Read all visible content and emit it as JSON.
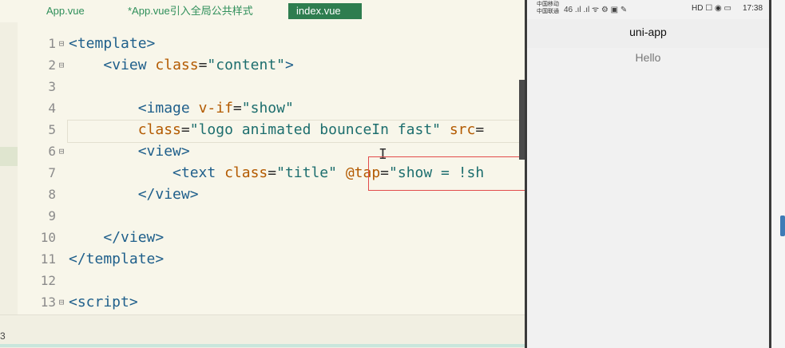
{
  "tabs": [
    {
      "label": "App.vue",
      "active": false
    },
    {
      "label": "*App.vue引入全局公共样式",
      "active": false
    },
    {
      "label": "index.vue",
      "active": true
    }
  ],
  "line_numbers": [
    "1",
    "2",
    "3",
    "4",
    "5",
    "6",
    "7",
    "8",
    "9",
    "10",
    "11",
    "12",
    "13"
  ],
  "code_lines": [
    {
      "indent": "",
      "tokens": [
        {
          "t": "<template>",
          "c": "tok-tag"
        }
      ]
    },
    {
      "indent": "    ",
      "tokens": [
        {
          "t": "<view ",
          "c": "tok-tag"
        },
        {
          "t": "class",
          "c": "tok-attr"
        },
        {
          "t": "=",
          "c": "tok-op"
        },
        {
          "t": "\"content\"",
          "c": "tok-str"
        },
        {
          "t": ">",
          "c": "tok-tag"
        }
      ]
    },
    {
      "indent": "",
      "tokens": []
    },
    {
      "indent": "        ",
      "tokens": [
        {
          "t": "<image ",
          "c": "tok-tag"
        },
        {
          "t": "v-if",
          "c": "tok-attr"
        },
        {
          "t": "=",
          "c": "tok-op"
        },
        {
          "t": "\"show\"",
          "c": "tok-str"
        }
      ]
    },
    {
      "indent": "        ",
      "tokens": [
        {
          "t": "class",
          "c": "tok-attr"
        },
        {
          "t": "=",
          "c": "tok-op"
        },
        {
          "t": "\"logo animated bounceIn fast\" ",
          "c": "tok-str"
        },
        {
          "t": "src",
          "c": "tok-attr"
        },
        {
          "t": "=",
          "c": "tok-op"
        }
      ]
    },
    {
      "indent": "        ",
      "tokens": [
        {
          "t": "<view>",
          "c": "tok-tag"
        }
      ]
    },
    {
      "indent": "            ",
      "tokens": [
        {
          "t": "<text ",
          "c": "tok-tag"
        },
        {
          "t": "class",
          "c": "tok-attr"
        },
        {
          "t": "=",
          "c": "tok-op"
        },
        {
          "t": "\"title\" ",
          "c": "tok-str"
        },
        {
          "t": "@tap",
          "c": "tok-attr"
        },
        {
          "t": "=",
          "c": "tok-op"
        },
        {
          "t": "\"show = !sh",
          "c": "tok-str"
        }
      ]
    },
    {
      "indent": "        ",
      "tokens": [
        {
          "t": "</view>",
          "c": "tok-tag"
        }
      ]
    },
    {
      "indent": "",
      "tokens": []
    },
    {
      "indent": "    ",
      "tokens": [
        {
          "t": "</view>",
          "c": "tok-tag"
        }
      ]
    },
    {
      "indent": "",
      "tokens": [
        {
          "t": "</template>",
          "c": "tok-tag"
        }
      ]
    },
    {
      "indent": "",
      "tokens": []
    },
    {
      "indent": "",
      "tokens": [
        {
          "t": "<script>",
          "c": "tok-tag"
        }
      ]
    }
  ],
  "bottom_left_text": "3",
  "phone": {
    "carrier_line1": "中国移动",
    "carrier_line2": "中国联通",
    "status_left_icons": "46 .ıl .ıl ᯤ ⚙ ▣ ✎",
    "status_right_icons": "HD ☐ ◉ ▭",
    "time": "17:38",
    "nav_title": "uni-app",
    "content_text": "Hello"
  }
}
